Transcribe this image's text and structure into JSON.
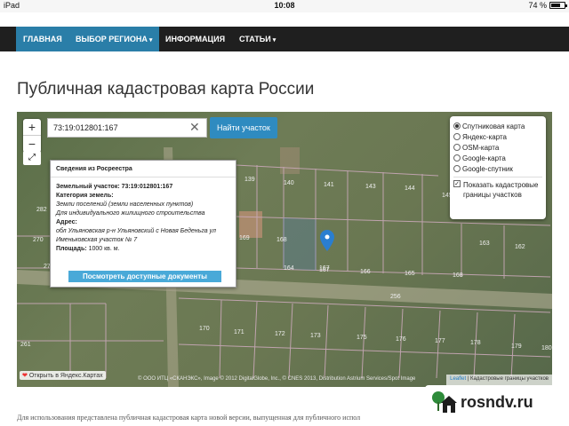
{
  "statusbar": {
    "device": "iPad",
    "time": "10:08",
    "battery": "74 %",
    "battery_level": 0.74
  },
  "nav": {
    "home": "ГЛАВНАЯ",
    "region": "ВЫБОР РЕГИОНА",
    "info": "ИНФОРМАЦИЯ",
    "articles": "СТАТЬИ"
  },
  "page_title": "Публичная кадастровая карта России",
  "map": {
    "zoom_in": "+",
    "zoom_out": "−",
    "search_value": "73:19:012801:167",
    "search_button": "Найти участок",
    "popup": {
      "title": "Сведения из Росреестра",
      "parcel_label": "Земельный участок:",
      "parcel_value": "73:19:012801:167",
      "category_label": "Категория земель:",
      "category_value": "Земли поселений (земли населенных пунктов)",
      "use_value": "Для индивидуального жилищного строительства",
      "address_label": "Адрес:",
      "address_value": "обл Ульяновская р-н Ульяновский с Новая Беденьга ул Именьковская участок № 7",
      "area_label": "Площадь:",
      "area_value": "1000 кв. м.",
      "docs_button": "Посмотреть доступные документы"
    },
    "layers": {
      "options": [
        "Спутниковая карта",
        "Яндекс-карта",
        "OSM-карта",
        "Google-карта",
        "Google-спутник"
      ],
      "selected_index": 0,
      "overlay": "Показать кадастровые границы участков",
      "overlay_checked": true
    },
    "parcel_numbers": [
      "139",
      "140",
      "141",
      "143",
      "144",
      "145",
      "145",
      "146",
      "164",
      "167",
      "168",
      "163",
      "162",
      "166",
      "165",
      "168",
      "169",
      "170",
      "171",
      "172",
      "173",
      "175",
      "176",
      "177",
      "178",
      "179",
      "180",
      "270",
      "276",
      "282",
      "261",
      "256",
      "167"
    ],
    "street_label": "Яндекс",
    "yandex_link": "Открыть в Яндекс.Картах",
    "copyright": "© ООО ИТЦ «СКАНЭКС», Image © 2012 DigitalGlobe, Inc., © CNES 2013, Distribution Astrium Services/Spot Image",
    "attribution_leaflet": "Leaflet",
    "attribution_text": "| Кадастровые границы участков"
  },
  "intro_text": "Для использования представлена публичная кадастровая карта новой версии, выпущенная для публичного испол",
  "brand": {
    "name": "rosndv.ru"
  },
  "colors": {
    "nav_bg": "#1f1f1f",
    "nav_active": "#2a7ea8",
    "button_blue": "#2f8bc0",
    "pin": "#2a7ed0",
    "parcel_line": "#c9a8b8"
  }
}
